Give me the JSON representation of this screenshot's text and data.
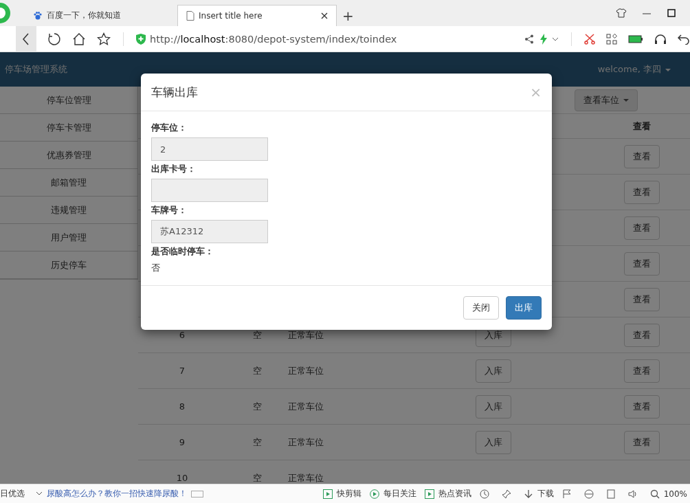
{
  "browser": {
    "tabs": [
      {
        "title": "百度一下，你就知道",
        "selected": false
      },
      {
        "title": "Insert title here",
        "selected": true
      }
    ],
    "new_tab": "+",
    "url_prefix": "http://",
    "url_host": "localhost",
    "url_rest": ":8080/depot-system/index/toindex"
  },
  "navbar": {
    "brand": "停车场管理系统",
    "user": "welcome, 李四"
  },
  "sidebar": {
    "items": [
      "停车位管理",
      "停车卡管理",
      "优惠券管理",
      "邮箱管理",
      "违规管理",
      "用户管理",
      "历史停车"
    ]
  },
  "toolbar": {
    "dropdown": "查看车位"
  },
  "table": {
    "header": "查看",
    "rows": [
      {
        "view_button": "查看"
      },
      {
        "view_button": "查看"
      },
      {
        "view_button": "查看"
      },
      {
        "view_button": "查看"
      },
      {
        "view_button": "查看"
      },
      {
        "number": "6",
        "status": "空",
        "type": "正常车位",
        "park_button": "入库",
        "view_button": "查看"
      },
      {
        "number": "7",
        "status": "空",
        "type": "正常车位",
        "park_button": "入库",
        "view_button": "查看"
      },
      {
        "number": "8",
        "status": "空",
        "type": "正常车位",
        "park_button": "入库",
        "view_button": "查看"
      },
      {
        "number": "9",
        "status": "空",
        "type": "正常车位",
        "park_button": "入库",
        "view_button": "查看"
      },
      {
        "number": "10",
        "status": "空",
        "type": "正常车位"
      }
    ]
  },
  "modal": {
    "title": "车辆出库",
    "close": "×",
    "fields": [
      {
        "kind": "input",
        "label": "停车位：",
        "value": "2",
        "disabled": true
      },
      {
        "kind": "input",
        "label": "出库卡号：",
        "disabled": true
      },
      {
        "kind": "input",
        "label": "车牌号：",
        "value": "苏A12312",
        "disabled": true
      },
      {
        "kind": "text",
        "label": "是否临时停车：",
        "value": "否"
      }
    ],
    "buttons": [
      {
        "label": "关闭",
        "primary": false
      },
      {
        "label": "出库",
        "primary": true
      }
    ]
  },
  "status_bar": {
    "left": "日优选",
    "news": "尿酸高怎么办？教你一招快速降尿酸！",
    "items": [
      "快剪辑",
      "每日关注",
      "热点资讯"
    ],
    "download": "下载",
    "zoom": "100%"
  }
}
